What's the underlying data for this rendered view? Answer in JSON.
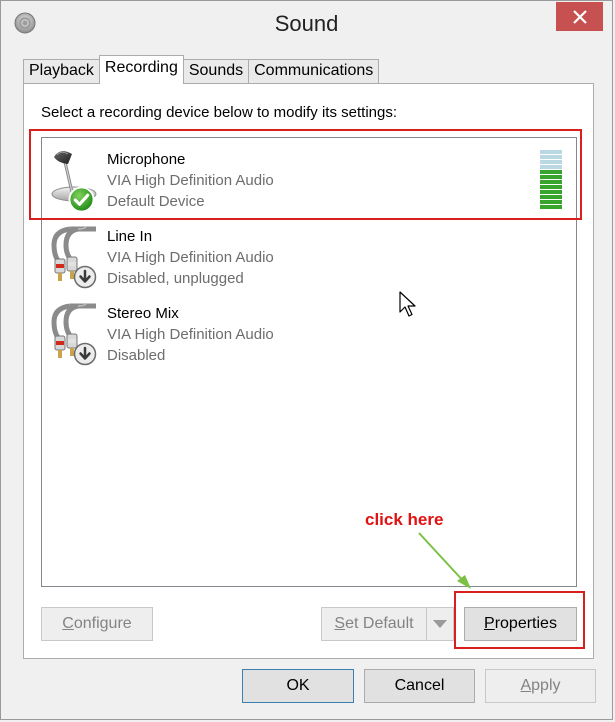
{
  "window": {
    "title": "Sound",
    "app_icon": "speaker-icon",
    "close_icon": "close-icon",
    "accent_close": "#c75050"
  },
  "tabs": [
    {
      "label": "Playback",
      "active": false
    },
    {
      "label": "Recording",
      "active": true
    },
    {
      "label": "Sounds",
      "active": false
    },
    {
      "label": "Communications",
      "active": false
    }
  ],
  "panel": {
    "instruction": "Select a recording device below to modify its settings:",
    "devices": [
      {
        "name": "Microphone",
        "driver": "VIA High Definition Audio",
        "status": "Default Device",
        "icon": "microphone-icon",
        "badge": "default-check-icon"
      },
      {
        "name": "Line In",
        "driver": "VIA High Definition Audio",
        "status": "Disabled, unplugged",
        "icon": "audio-cable-icon",
        "badge": "disabled-down-arrow-icon"
      },
      {
        "name": "Stereo Mix",
        "driver": "VIA High Definition Audio",
        "status": "Disabled",
        "icon": "audio-cable-icon",
        "badge": "disabled-down-arrow-icon"
      }
    ],
    "level_meter": {
      "active_segments": 8,
      "total_segments": 12,
      "active_color": "#37a42c",
      "inactive_color": "#b9d8e3"
    },
    "buttons": {
      "configure": {
        "mnemonic": "C",
        "rest": "onfigure",
        "enabled": false
      },
      "set_default": {
        "mnemonic": "S",
        "rest": "et Default",
        "enabled": false
      },
      "properties": {
        "mnemonic": "P",
        "rest": "roperties",
        "enabled": true
      }
    }
  },
  "annotation": {
    "text": "click here",
    "color": "#e01212",
    "arrow_color": "#7ac143"
  },
  "dialog_buttons": {
    "ok": "OK",
    "cancel": "Cancel",
    "apply": {
      "mnemonic": "A",
      "rest": "pply",
      "enabled": false
    }
  }
}
